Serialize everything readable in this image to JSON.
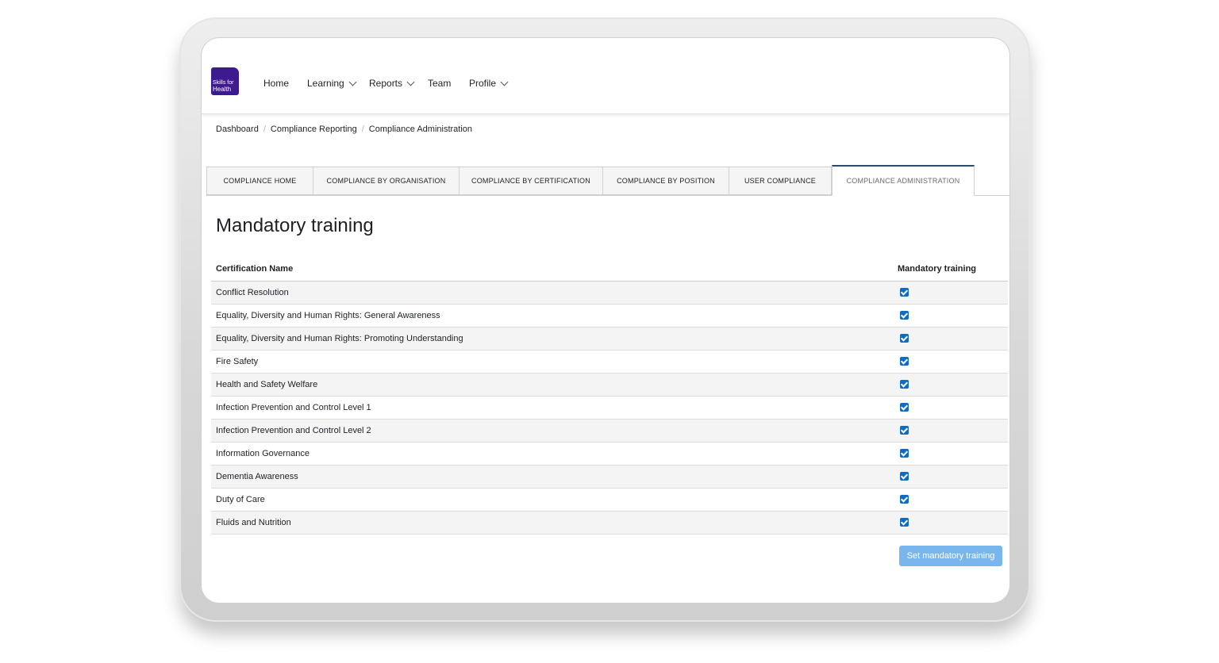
{
  "brand": {
    "logo_line1": "Skills for",
    "logo_line2": "Health",
    "logo_color": "#3d1a8e"
  },
  "nav": {
    "home": "Home",
    "learning": "Learning",
    "reports": "Reports",
    "team": "Team",
    "profile": "Profile"
  },
  "breadcrumb": [
    "Dashboard",
    "Compliance Reporting",
    "Compliance Administration"
  ],
  "tabs": [
    {
      "label": "COMPLIANCE HOME",
      "active": false
    },
    {
      "label": "COMPLIANCE BY ORGANISATION",
      "active": false
    },
    {
      "label": "COMPLIANCE BY CERTIFICATION",
      "active": false
    },
    {
      "label": "COMPLIANCE BY POSITION",
      "active": false
    },
    {
      "label": "USER COMPLIANCE",
      "active": false
    },
    {
      "label": "COMPLIANCE ADMINISTRATION",
      "active": true
    }
  ],
  "page": {
    "title": "Mandatory training"
  },
  "table": {
    "headers": {
      "name": "Certification Name",
      "mandatory": "Mandatory training"
    },
    "rows": [
      {
        "name": "Conflict Resolution",
        "checked": true
      },
      {
        "name": "Equality, Diversity and Human Rights: General Awareness",
        "checked": true
      },
      {
        "name": "Equality, Diversity and Human Rights: Promoting Understanding",
        "checked": true
      },
      {
        "name": "Fire Safety",
        "checked": true
      },
      {
        "name": "Health and Safety Welfare",
        "checked": true
      },
      {
        "name": "Infection Prevention and Control Level 1",
        "checked": true
      },
      {
        "name": "Infection Prevention and Control Level 2",
        "checked": true
      },
      {
        "name": "Information Governance",
        "checked": true
      },
      {
        "name": "Dementia Awareness",
        "checked": true
      },
      {
        "name": "Duty of Care",
        "checked": true
      },
      {
        "name": "Fluids and Nutrition",
        "checked": true
      }
    ]
  },
  "actions": {
    "submit_label": "Set mandatory training"
  },
  "colors": {
    "accent": "#0f6cbf",
    "button": "#7ab6ee",
    "active_tab_border": "#2a4a6e"
  }
}
